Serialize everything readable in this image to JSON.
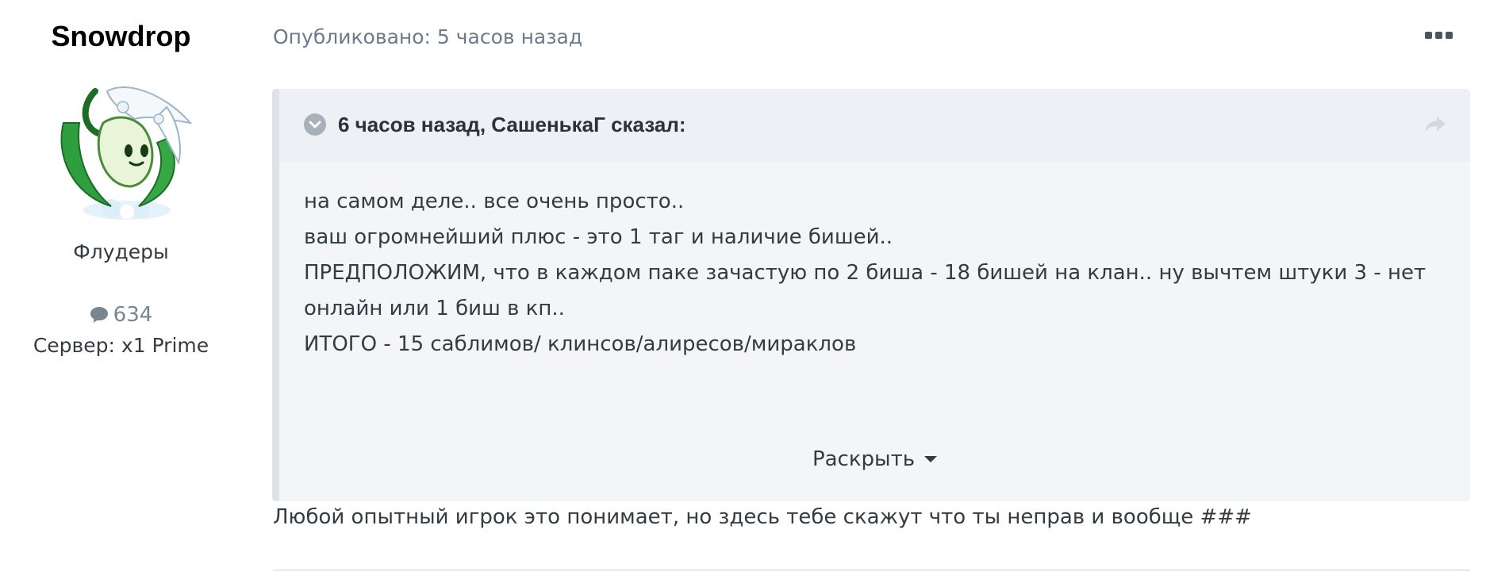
{
  "author": {
    "name": "Snowdrop",
    "group": "Флудеры",
    "posts_count": "634",
    "server": "Сервер: x1 Prime"
  },
  "post": {
    "meta": "Опубликовано: 5 часов назад",
    "quote": {
      "citation": "6 часов назад, СашенькаГ сказал:",
      "lines": [
        "на самом деле.. все очень просто..",
        "ваш огромнейший плюс - это 1 таг и наличие бишей..",
        "ПРЕДПОЛОЖИМ, что в каждом паке зачастую по 2 биша - 18 бишей на клан.. ну вычтем штуки 3 - нет",
        "онлайн или 1 биш в кп..",
        "ИТОГО - 15 саблимов/ клинсов/алиресов/мираклов"
      ],
      "expand_label": "Раскрыть"
    },
    "text": "Любой опытный игрок это понимает, но здесь тебе скажут что ты неправ и вообще ###"
  },
  "icons": {
    "posts": "comment-icon",
    "menu": "ellipsis-icon",
    "toggle": "chevron-down-circle-icon",
    "share": "share-icon",
    "expand": "caret-down-icon"
  },
  "colors": {
    "quote_bg": "#f3f5f8",
    "quote_border": "#dfe3e8",
    "meta": "#6b7a8c"
  }
}
